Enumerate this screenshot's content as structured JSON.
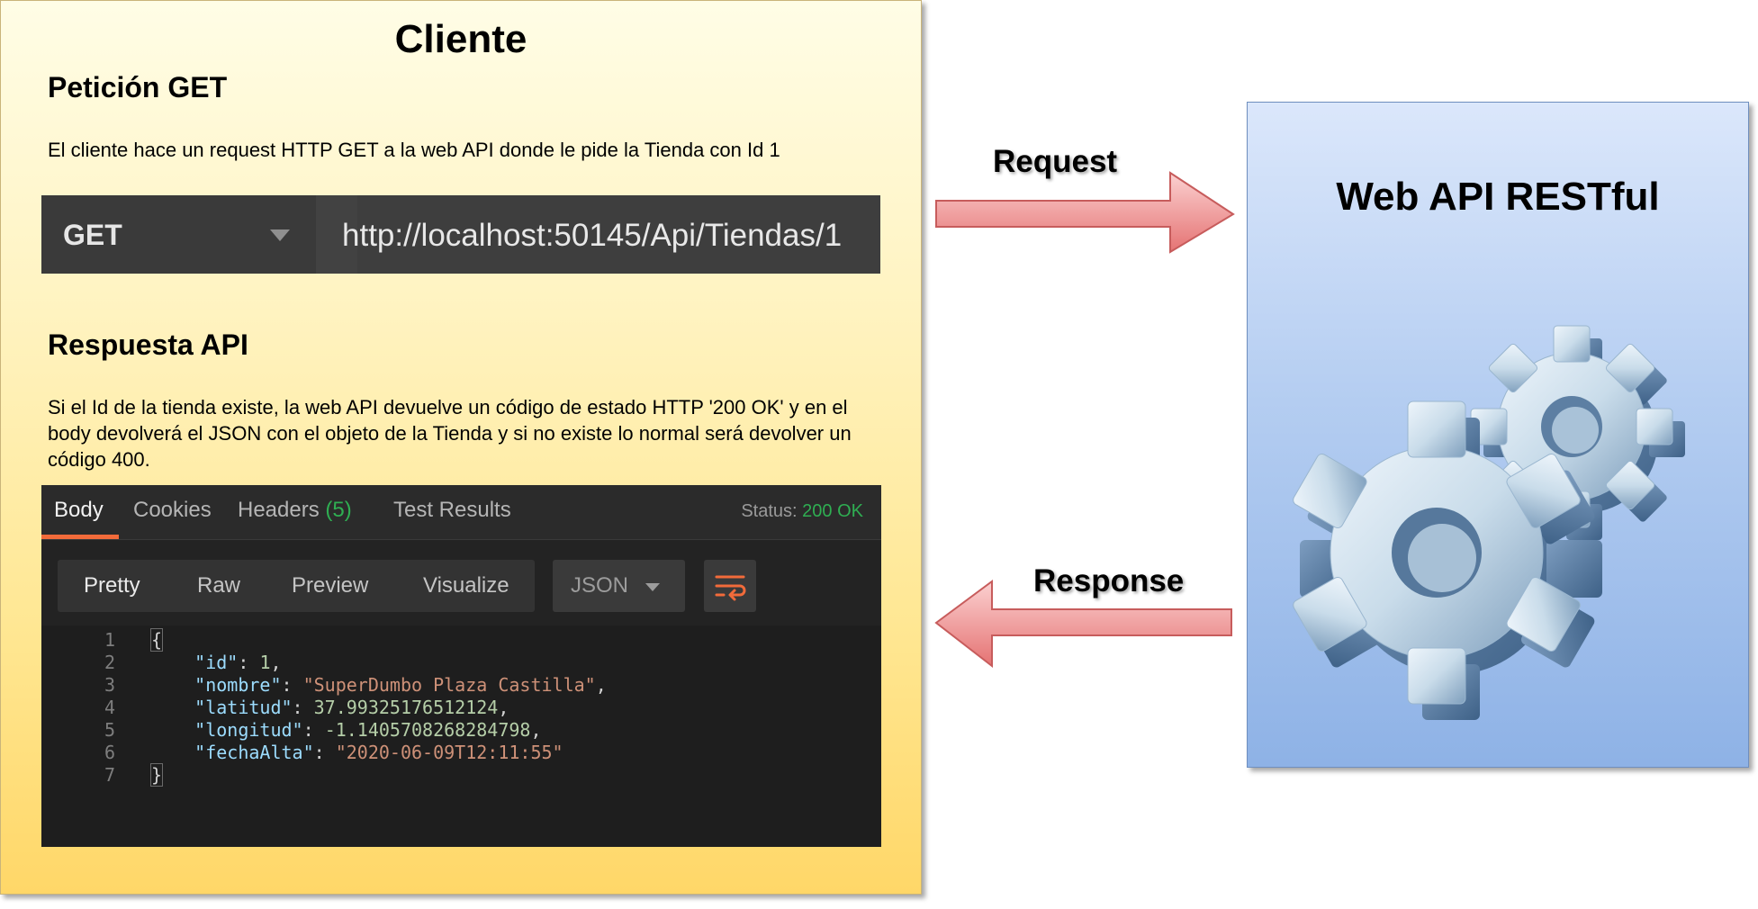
{
  "client": {
    "title": "Cliente",
    "request_heading": "Petición GET",
    "request_desc": "El cliente hace un request HTTP GET a la web API donde le pide la Tienda con Id 1",
    "get_bar": {
      "method": "GET",
      "url": "http://localhost:50145/Api/Tiendas/1"
    },
    "response_heading": "Respuesta API",
    "response_desc": "Si el Id de la tienda existe, la web API devuelve un código de estado HTTP '200 OK' y en el body devolverá el JSON con el objeto de la Tienda y si no existe lo normal será devolver un código 400.",
    "response_panel": {
      "tabs": [
        {
          "label": "Body"
        },
        {
          "label": "Cookies"
        },
        {
          "label": "Headers",
          "count": "(5)"
        },
        {
          "label": "Test Results"
        }
      ],
      "status_label": "Status:",
      "status_value": "200 OK",
      "view_modes": [
        "Pretty",
        "Raw",
        "Preview",
        "Visualize"
      ],
      "format": "JSON",
      "line_numbers": [
        "1",
        "2",
        "3",
        "4",
        "5",
        "6",
        "7"
      ],
      "json": {
        "open": "{",
        "close": "}",
        "fields": [
          {
            "key": "\"id\"",
            "value": "1",
            "type": "number",
            "comma": ","
          },
          {
            "key": "\"nombre\"",
            "value": "\"SuperDumbo Plaza Castilla\"",
            "type": "string",
            "comma": ","
          },
          {
            "key": "\"latitud\"",
            "value": "37.99325176512124",
            "type": "number",
            "comma": ","
          },
          {
            "key": "\"longitud\"",
            "value": "-1.1405708268284798",
            "type": "number",
            "comma": ","
          },
          {
            "key": "\"fechaAlta\"",
            "value": "\"2020-06-09T12:11:55\"",
            "type": "string",
            "comma": ""
          }
        ]
      }
    }
  },
  "arrows": {
    "request_label": "Request",
    "response_label": "Response"
  },
  "api": {
    "title": "Web API RESTful",
    "icon": "gears-icon"
  },
  "colors": {
    "client_bg": "#ffe793",
    "api_bg": "#b4cdf1",
    "arrow_fill": "#ee8e8e",
    "status_ok": "#2fae52",
    "accent": "#f26b3a"
  }
}
